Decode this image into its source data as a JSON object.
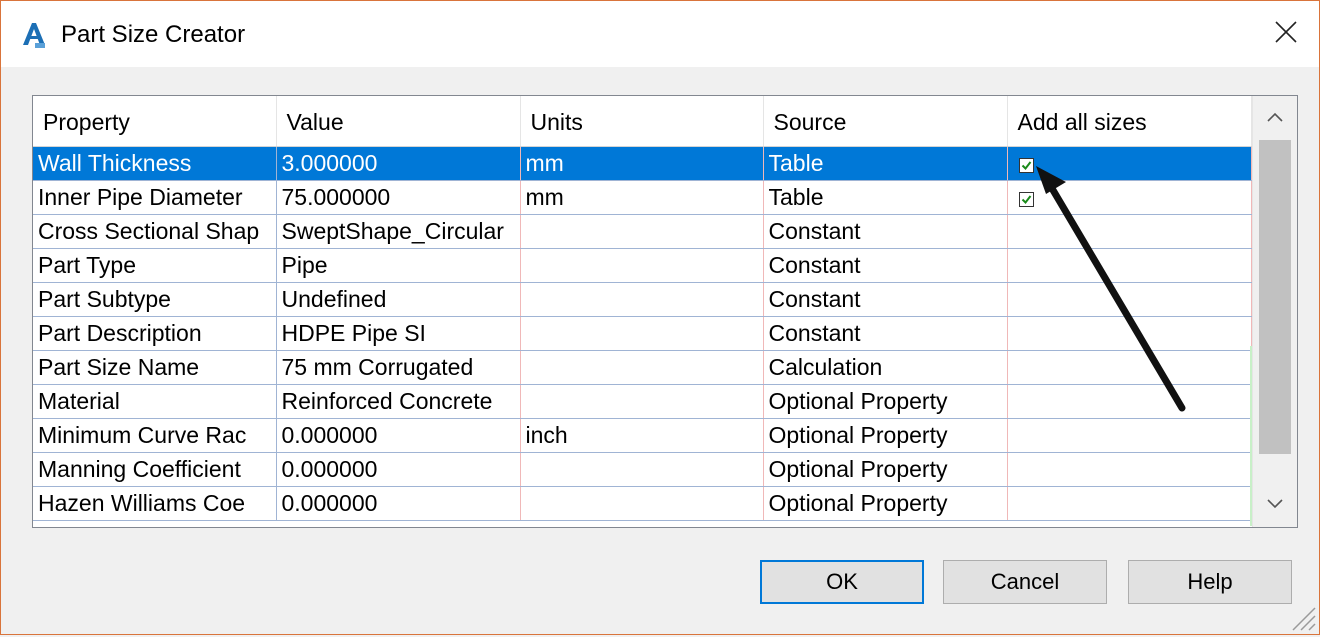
{
  "window": {
    "title": "Part Size Creator",
    "accent_color": "#0078d7",
    "border_color": "#d9743b"
  },
  "table": {
    "columns": [
      "Property",
      "Value",
      "Units",
      "Source",
      "Add all sizes"
    ],
    "rows": [
      {
        "property": "Wall Thickness",
        "value": "3.000000",
        "units": "mm",
        "source": "Table",
        "add_all_sizes": true,
        "selected": true
      },
      {
        "property": "Inner Pipe Diameter",
        "value": "75.000000",
        "units": "mm",
        "source": "Table",
        "add_all_sizes": true,
        "selected": false
      },
      {
        "property": "Cross Sectional Shap",
        "value": "SweptShape_Circular",
        "units": "",
        "source": "Constant",
        "add_all_sizes": null,
        "selected": false
      },
      {
        "property": "Part Type",
        "value": "Pipe",
        "units": "",
        "source": "Constant",
        "add_all_sizes": null,
        "selected": false
      },
      {
        "property": "Part Subtype",
        "value": "Undefined",
        "units": "",
        "source": "Constant",
        "add_all_sizes": null,
        "selected": false
      },
      {
        "property": "Part Description",
        "value": "HDPE Pipe SI",
        "units": "",
        "source": "Constant",
        "add_all_sizes": null,
        "selected": false
      },
      {
        "property": "Part Size Name",
        "value": "75 mm Corrugated",
        "units": "",
        "source": "Calculation",
        "add_all_sizes": null,
        "selected": false
      },
      {
        "property": "Material",
        "value": "Reinforced Concrete",
        "units": "",
        "source": "Optional Property",
        "add_all_sizes": null,
        "selected": false
      },
      {
        "property": "Minimum Curve Rac",
        "value": "0.000000",
        "units": "inch",
        "source": "Optional Property",
        "add_all_sizes": null,
        "selected": false
      },
      {
        "property": "Manning Coefficient",
        "value": "0.000000",
        "units": "",
        "source": "Optional Property",
        "add_all_sizes": null,
        "selected": false
      },
      {
        "property": "Hazen Williams Coe",
        "value": "0.000000",
        "units": "",
        "source": "Optional Property",
        "add_all_sizes": null,
        "selected": false
      }
    ]
  },
  "buttons": {
    "ok": "OK",
    "cancel": "Cancel",
    "help": "Help"
  },
  "icons": {
    "app": "autocad-civil3d-icon",
    "close": "close-icon",
    "scroll_up": "chevron-up-icon",
    "scroll_down": "chevron-down-icon"
  }
}
